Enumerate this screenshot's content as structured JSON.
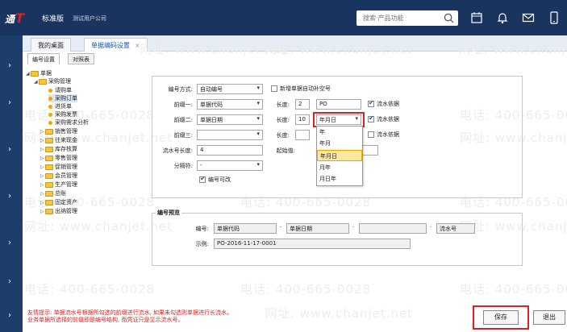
{
  "topbar": {
    "logo": "通",
    "logo_t": "T",
    "edition": "标准版",
    "company": "测试用户公司",
    "search_placeholder": "搜索·产品功能"
  },
  "tabs": {
    "home": "我的桌面",
    "active": "单据编码设置"
  },
  "subtabs": {
    "numbering": "编号设置",
    "reference": "对照表"
  },
  "tree": {
    "root": "单据",
    "group": "采购管理",
    "items": [
      "请购单",
      "采购订单",
      "进货单",
      "采购发票",
      "采购需求分析"
    ],
    "folders": [
      "销售管理",
      "往来现金",
      "库存核算",
      "零售管理",
      "促销管理",
      "会员管理",
      "生产管理",
      "总账",
      "固定资产",
      "出纳管理"
    ]
  },
  "form": {
    "mode_label": "编号方式:",
    "mode_value": "自动编号",
    "manual_label": "新增单据自动补空号",
    "prefix1_label": "前缀一:",
    "prefix1_value": "单据代码",
    "len_label": "长度:",
    "prefix1_len": "2",
    "prefix1_text": "PO",
    "serial_label": "流水依据",
    "prefix2_label": "前缀二:",
    "prefix2_value": "单据日期",
    "prefix2_len": "10",
    "prefix2_format": "年月日",
    "prefix3_label": "前缀三:",
    "serial_len_label": "流水号长度:",
    "serial_len_value": "4",
    "start_label": "起始值:",
    "sep_label": "分隔符:",
    "sep_value": "-",
    "editable_label": "编号可改"
  },
  "dropdown": {
    "options": [
      "年",
      "年月",
      "年月日",
      "月年",
      "月日年"
    ],
    "highlighted": 2
  },
  "preview": {
    "title": "编号预览",
    "code_label": "编号:",
    "parts": [
      "单据代码",
      "单据日期",
      "流水号"
    ],
    "example_label": "示例:",
    "example_value": "PO-2016-11-17-0001"
  },
  "tips": [
    "友情提示: 单据流水号根据所勾选的前缀进行流水, 如果未勾选则单据进行长流水。",
    "业务单据所选择的前缀即是编号结构, 而凭证只是显示流水号。"
  ],
  "buttons": {
    "save": "保存",
    "exit": "退出"
  },
  "watermarks": {
    "site": "网址: www.chanjet.net",
    "phone": "电话: 400-665-0028"
  },
  "colors": {
    "topbar": "#18345f",
    "accent": "#1a56a8",
    "highlight_red": "#e02020",
    "highlight_yellow": "#fbe79d"
  }
}
